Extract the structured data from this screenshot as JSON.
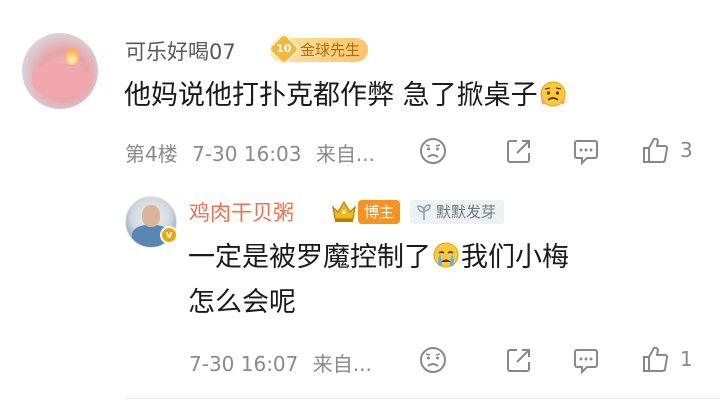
{
  "comment1": {
    "username": "可乐好喝07",
    "badge_level": "10",
    "badge_label": "金球先生",
    "text": "他妈说他打扑克都作弊 急了掀桌子",
    "floor": "第4楼",
    "timestamp": "7-30 16:03",
    "source": "来自...",
    "like_count": "3"
  },
  "reply1": {
    "username": "鸡肉干贝粥",
    "role_badge": "博主",
    "sprout_badge": "默默发芽",
    "text_line1": "一定是被罗魔控制了",
    "text_line1_tail": "我们小梅",
    "text_line2": "怎么会呢",
    "timestamp": "7-30 16:07",
    "source": "来自...",
    "like_count": "1"
  },
  "colors": {
    "blogger_name": "#eb7350",
    "gold_badge": "#f8c56a",
    "blogger_badge": "#f7931e",
    "meta_text": "#8a8a8a"
  },
  "icons": [
    "dislike-icon",
    "share-icon",
    "comment-icon",
    "like-icon",
    "crown-icon",
    "sprout-icon",
    "verified-icon",
    "emoji-worried",
    "emoji-crying"
  ]
}
